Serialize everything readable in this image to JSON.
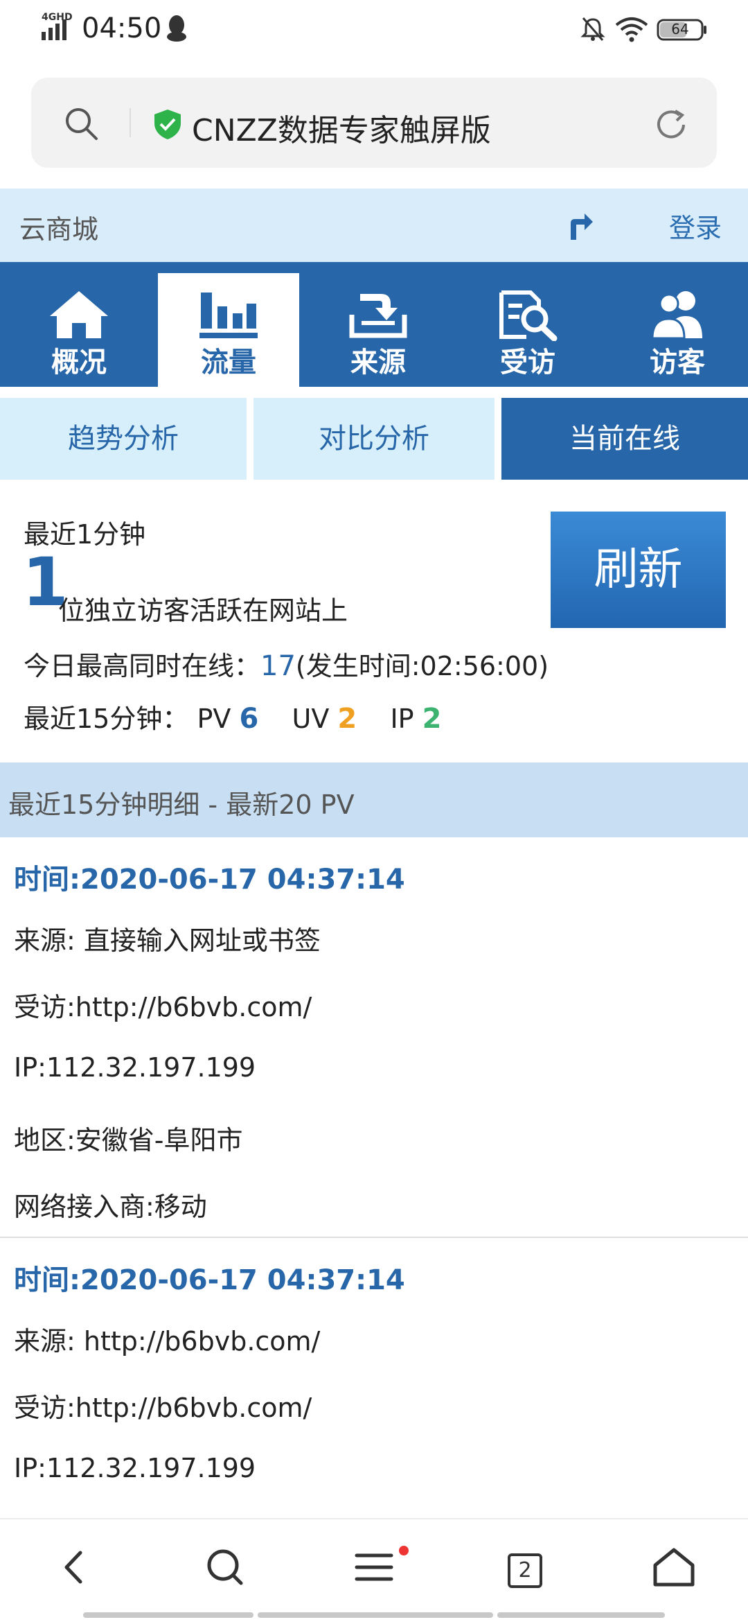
{
  "status_bar": {
    "network": "4GHD",
    "time": "04:50",
    "battery": "64"
  },
  "address_bar": {
    "title": "CNZZ数据专家触屏版"
  },
  "site_header": {
    "site_name": "云商城",
    "login_label": "登录"
  },
  "main_nav": [
    {
      "label": "概况",
      "icon": "home-icon"
    },
    {
      "label": "流量",
      "icon": "bar-chart-icon",
      "active": true
    },
    {
      "label": "来源",
      "icon": "source-tray-icon"
    },
    {
      "label": "受访",
      "icon": "magnifier-page-icon"
    },
    {
      "label": "访客",
      "icon": "users-icon"
    }
  ],
  "sub_tabs": [
    {
      "label": "趋势分析"
    },
    {
      "label": "对比分析"
    },
    {
      "label": "当前在线",
      "active": true
    }
  ],
  "summary": {
    "recent_label": "最近1分钟",
    "active_count": "1",
    "active_desc": "位独立访客活跃在网站上",
    "refresh_label": "刷新",
    "peak_label": "今日最高同时在线：",
    "peak_value": "17",
    "peak_time": "(发生时间:02:56:00)",
    "last15_label": "最近15分钟：",
    "pv_label": "PV",
    "pv_value": "6",
    "uv_label": "UV",
    "uv_value": "2",
    "ip_label": "IP",
    "ip_value": "2"
  },
  "detail_header": {
    "title": "最近15分钟明细 - 最新20 PV"
  },
  "records": [
    {
      "time": "时间:2020-06-17 04:37:14",
      "source": "来源: 直接输入网址或书签",
      "visited": "受访:http://b6bvb.com/",
      "ip": "IP:112.32.197.199",
      "region": "地区:安徽省-阜阳市",
      "isp": "网络接入商:移动"
    },
    {
      "time": "时间:2020-06-17 04:37:14",
      "source": "来源: http://b6bvb.com/",
      "visited": "受访:http://b6bvb.com/",
      "ip": "IP:112.32.197.199"
    }
  ],
  "bottom_bar": {
    "tab_count": "2"
  },
  "colors": {
    "primary": "#2766a8",
    "light_blue": "#d9ecfa",
    "tab_bg": "#d6effa",
    "orange": "#f0a020",
    "green": "#3cb371"
  }
}
